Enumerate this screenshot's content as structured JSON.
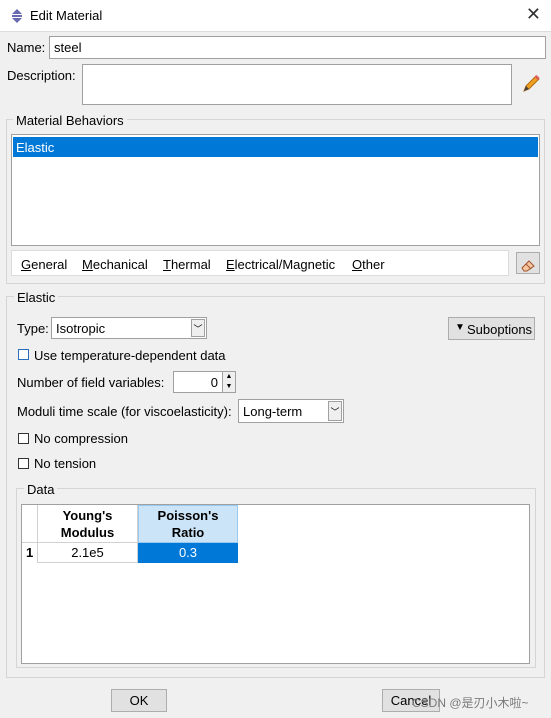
{
  "window": {
    "title": "Edit Material",
    "close_glyph": "✕"
  },
  "name": {
    "label": "Name:",
    "value": "steel"
  },
  "description": {
    "label": "Description:",
    "value": ""
  },
  "behaviors": {
    "legend": "Material Behaviors",
    "items": [
      {
        "label": "Elastic",
        "selected": true
      }
    ],
    "selection_color": "#0078d7"
  },
  "tabs": [
    {
      "mnemonic": "G",
      "rest": "eneral"
    },
    {
      "mnemonic": "M",
      "rest": "echanical"
    },
    {
      "mnemonic": "T",
      "rest": "hermal"
    },
    {
      "mnemonic": "E",
      "rest": "lectrical/Magnetic"
    },
    {
      "mnemonic": "O",
      "rest": "ther"
    }
  ],
  "elastic": {
    "legend": "Elastic",
    "type_label": "Type:",
    "type_value": "Isotropic",
    "suboptions_label": "Suboptions",
    "temp_dependent_label": "Use temperature-dependent data",
    "field_vars_label": "Number of field variables:",
    "field_vars_value": "0",
    "moduli_label": "Moduli time scale (for viscoelasticity):",
    "moduli_value": "Long-term",
    "no_compression_label": "No compression",
    "no_tension_label": "No tension"
  },
  "data_table": {
    "legend": "Data",
    "headers": [
      [
        "Young's",
        "Modulus"
      ],
      [
        "Poisson's",
        "Ratio"
      ]
    ],
    "rows": [
      {
        "index": "1",
        "values": [
          "2.1e5",
          "0.3"
        ]
      }
    ]
  },
  "buttons": {
    "ok": "OK",
    "cancel": "Cancel"
  },
  "watermark": "CSDN @是刃小木啦~"
}
